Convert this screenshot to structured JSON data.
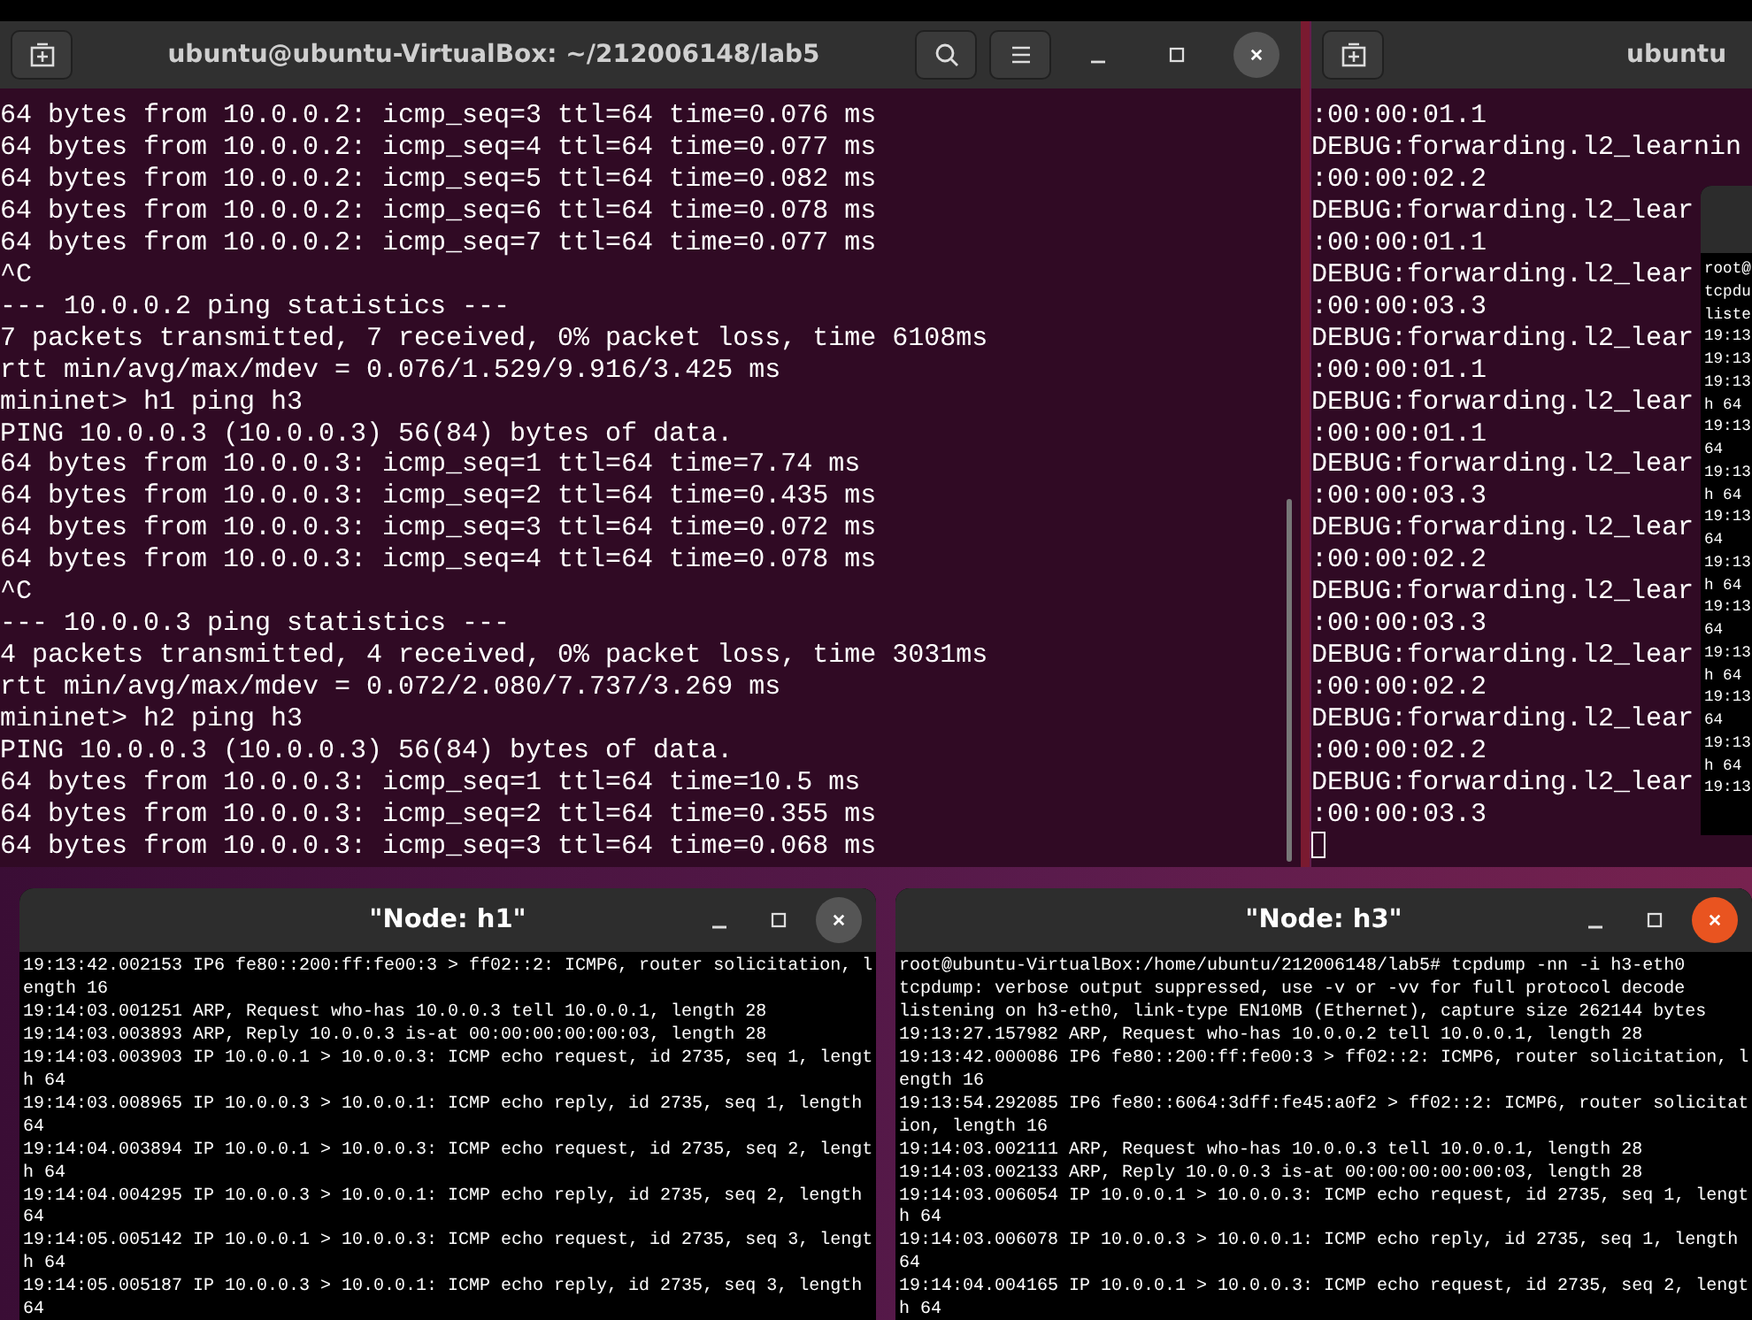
{
  "main_terminal": {
    "title": "ubuntu@ubuntu-VirtualBox: ~/212006148/lab5",
    "lines": [
      "64 bytes from 10.0.0.2: icmp_seq=3 ttl=64 time=0.076 ms",
      "64 bytes from 10.0.0.2: icmp_seq=4 ttl=64 time=0.077 ms",
      "64 bytes from 10.0.0.2: icmp_seq=5 ttl=64 time=0.082 ms",
      "64 bytes from 10.0.0.2: icmp_seq=6 ttl=64 time=0.078 ms",
      "64 bytes from 10.0.0.2: icmp_seq=7 ttl=64 time=0.077 ms",
      "^C",
      "--- 10.0.0.2 ping statistics ---",
      "7 packets transmitted, 7 received, 0% packet loss, time 6108ms",
      "rtt min/avg/max/mdev = 0.076/1.529/9.916/3.425 ms",
      "mininet> h1 ping h3",
      "PING 10.0.0.3 (10.0.0.3) 56(84) bytes of data.",
      "64 bytes from 10.0.0.3: icmp_seq=1 ttl=64 time=7.74 ms",
      "64 bytes from 10.0.0.3: icmp_seq=2 ttl=64 time=0.435 ms",
      "64 bytes from 10.0.0.3: icmp_seq=3 ttl=64 time=0.072 ms",
      "64 bytes from 10.0.0.3: icmp_seq=4 ttl=64 time=0.078 ms",
      "^C",
      "--- 10.0.0.3 ping statistics ---",
      "4 packets transmitted, 4 received, 0% packet loss, time 3031ms",
      "rtt min/avg/max/mdev = 0.072/2.080/7.737/3.269 ms",
      "mininet> h2 ping h3",
      "PING 10.0.0.3 (10.0.0.3) 56(84) bytes of data.",
      "64 bytes from 10.0.0.3: icmp_seq=1 ttl=64 time=10.5 ms",
      "64 bytes from 10.0.0.3: icmp_seq=2 ttl=64 time=0.355 ms",
      "64 bytes from 10.0.0.3: icmp_seq=3 ttl=64 time=0.068 ms"
    ]
  },
  "right_terminal": {
    "title": "ubuntu",
    "lines": [
      ":00:00:01.1",
      "DEBUG:forwarding.l2_learnin",
      ":00:00:02.2",
      "DEBUG:forwarding.l2_lear",
      ":00:00:01.1",
      "DEBUG:forwarding.l2_lear",
      ":00:00:03.3",
      "DEBUG:forwarding.l2_lear",
      ":00:00:01.1",
      "DEBUG:forwarding.l2_lear",
      ":00:00:01.1",
      "DEBUG:forwarding.l2_lear",
      ":00:00:03.3",
      "DEBUG:forwarding.l2_lear",
      ":00:00:02.2",
      "DEBUG:forwarding.l2_lear",
      ":00:00:03.3",
      "DEBUG:forwarding.l2_lear",
      ":00:00:02.2",
      "DEBUG:forwarding.l2_lear",
      ":00:00:02.2",
      "DEBUG:forwarding.l2_lear",
      ":00:00:03.3"
    ]
  },
  "mini_xterm": {
    "lines": [
      "root@",
      "tcpdu",
      "liste",
      "19:13",
      "19:13",
      "19:13",
      "h 64",
      "19:13",
      "64",
      "19:13",
      "h 64",
      "19:13",
      "64",
      "19:13",
      "h 64",
      "19:13",
      "64",
      "19:13",
      "h 64",
      "19:13",
      "64",
      "19:13",
      "h 64",
      "19:13"
    ]
  },
  "node_windows": [
    {
      "title": "\"Node: h1\"",
      "focused": false,
      "lines": [
        "19:13:42.002153 IP6 fe80::200:ff:fe00:3 > ff02::2: ICMP6, router solicitation, l",
        "ength 16",
        "19:14:03.001251 ARP, Request who-has 10.0.0.3 tell 10.0.0.1, length 28",
        "19:14:03.003893 ARP, Reply 10.0.0.3 is-at 00:00:00:00:00:03, length 28",
        "19:14:03.003903 IP 10.0.0.1 > 10.0.0.3: ICMP echo request, id 2735, seq 1, lengt",
        "h 64",
        "19:14:03.008965 IP 10.0.0.3 > 10.0.0.1: ICMP echo reply, id 2735, seq 1, length",
        "64",
        "19:14:04.003894 IP 10.0.0.1 > 10.0.0.3: ICMP echo request, id 2735, seq 2, lengt",
        "h 64",
        "19:14:04.004295 IP 10.0.0.3 > 10.0.0.1: ICMP echo reply, id 2735, seq 2, length",
        "64",
        "19:14:05.005142 IP 10.0.0.1 > 10.0.0.3: ICMP echo request, id 2735, seq 3, lengt",
        "h 64",
        "19:14:05.005187 IP 10.0.0.3 > 10.0.0.1: ICMP echo reply, id 2735, seq 3, length",
        "64"
      ]
    },
    {
      "title": "\"Node: h3\"",
      "focused": true,
      "lines": [
        "root@ubuntu-VirtualBox:/home/ubuntu/212006148/lab5# tcpdump -nn -i h3-eth0",
        "tcpdump: verbose output suppressed, use -v or -vv for full protocol decode",
        "listening on h3-eth0, link-type EN10MB (Ethernet), capture size 262144 bytes",
        "19:13:27.157982 ARP, Request who-has 10.0.0.2 tell 10.0.0.1, length 28",
        "19:13:42.000086 IP6 fe80::200:ff:fe00:3 > ff02::2: ICMP6, router solicitation, l",
        "ength 16",
        "19:13:54.292085 IP6 fe80::6064:3dff:fe45:a0f2 > ff02::2: ICMP6, router solicitat",
        "ion, length 16",
        "19:14:03.002111 ARP, Request who-has 10.0.0.3 tell 10.0.0.1, length 28",
        "19:14:03.002133 ARP, Reply 10.0.0.3 is-at 00:00:00:00:00:03, length 28",
        "19:14:03.006054 IP 10.0.0.1 > 10.0.0.3: ICMP echo request, id 2735, seq 1, lengt",
        "h 64",
        "19:14:03.006078 IP 10.0.0.3 > 10.0.0.1: ICMP echo reply, id 2735, seq 1, length",
        "64",
        "19:14:04.004165 IP 10.0.0.1 > 10.0.0.3: ICMP echo request, id 2735, seq 2, lengt",
        "h 64"
      ]
    }
  ]
}
